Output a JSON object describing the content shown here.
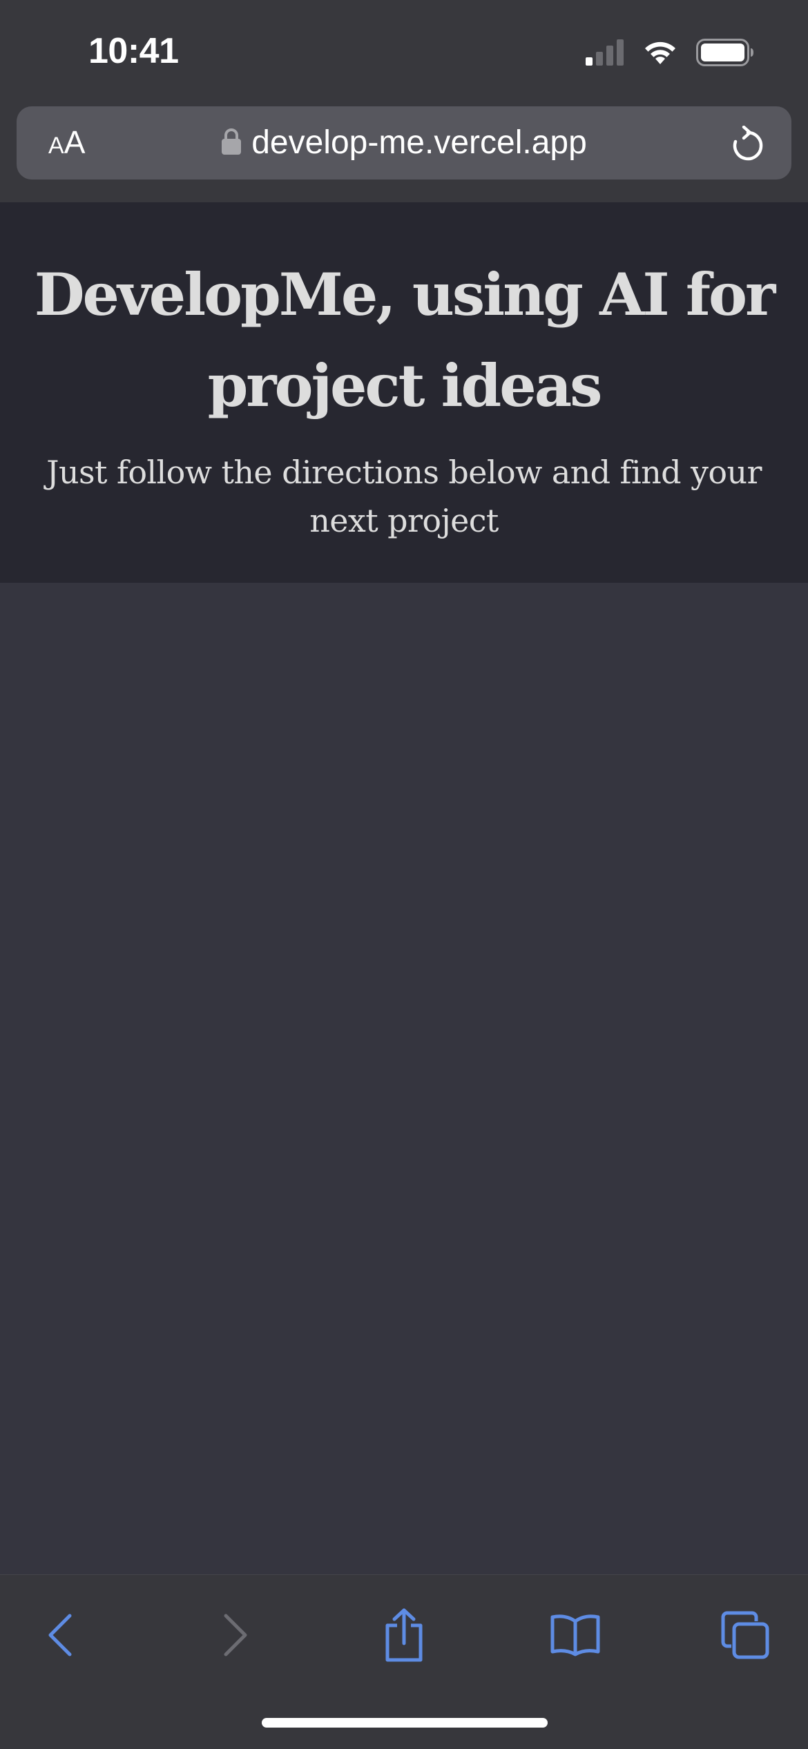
{
  "status_bar": {
    "time": "10:41",
    "icons": [
      "cellular-signal-icon",
      "wifi-icon",
      "battery-icon"
    ]
  },
  "browser": {
    "aa_small": "A",
    "aa_large": "A",
    "url": "develop-me.vercel.app",
    "icons": [
      "lock-icon",
      "reload-icon"
    ]
  },
  "page": {
    "title": "DevelopMe, using AI for project ideas",
    "subtitle": "Just follow the directions below and find your next project"
  },
  "toolbar": {
    "icons": [
      "back-icon",
      "forward-icon",
      "share-icon",
      "bookmarks-icon",
      "tabs-icon"
    ]
  },
  "colors": {
    "accent": "#5e8ce4",
    "hero_background": "#272730",
    "page_background": "#35353f",
    "chrome_background": "#38383d",
    "text": "#dddddd"
  }
}
